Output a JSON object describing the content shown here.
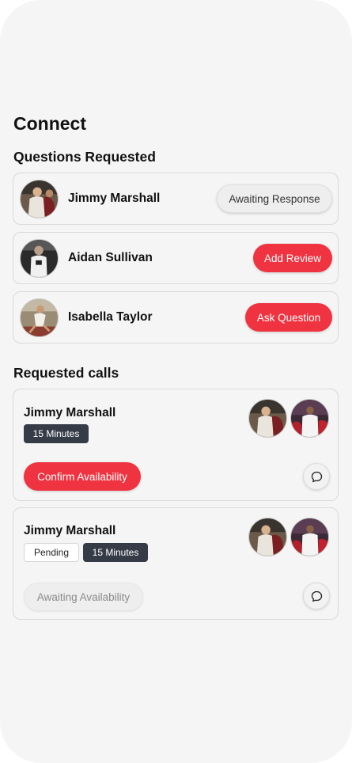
{
  "page": {
    "title": "Connect"
  },
  "questions": {
    "section_title": "Questions Requested",
    "items": [
      {
        "name": "Jimmy Marshall",
        "action_label": "Awaiting Response",
        "action_style": "grey"
      },
      {
        "name": "Aidan Sullivan",
        "action_label": "Add Review",
        "action_style": "red"
      },
      {
        "name": "Isabella Taylor",
        "action_label": "Ask Question",
        "action_style": "red"
      }
    ]
  },
  "calls": {
    "section_title": "Requested calls",
    "items": [
      {
        "name": "Jimmy Marshall",
        "tags": [
          "15 Minutes"
        ],
        "action_label": "Confirm Availability",
        "action_style": "red"
      },
      {
        "name": "Jimmy Marshall",
        "tags": [
          "Pending",
          "15 Minutes"
        ],
        "action_label": "Awaiting Availability",
        "action_style": "disabled"
      }
    ]
  },
  "icons": {
    "chat": "chat-bubble-icon"
  },
  "colors": {
    "accent_red": "#ef3340",
    "tag_dark": "#353c47",
    "background": "#f5f5f5"
  }
}
